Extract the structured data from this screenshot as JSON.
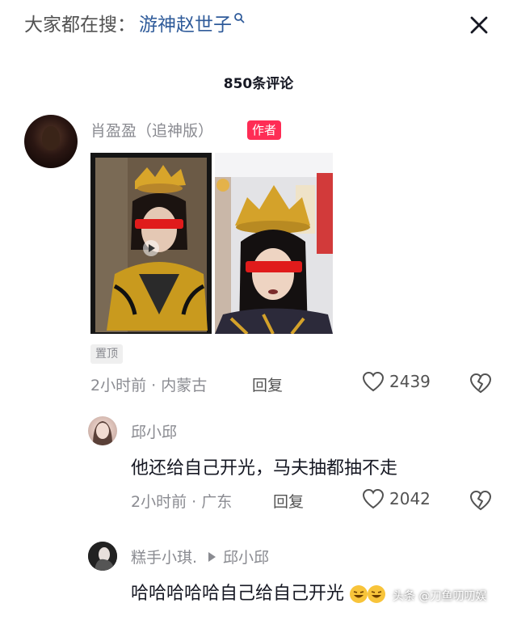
{
  "header": {
    "search_prefix": "大家都在搜：",
    "search_term": "游神赵世子",
    "close_icon": "close-icon"
  },
  "comments": {
    "count_label": "850条评论"
  },
  "main_comment": {
    "author": "肖盈盈（追神版）",
    "author_badge": "作者",
    "pinned": "置顶",
    "time_location": "2小时前 · 内蒙古",
    "reply_label": "回复",
    "likes": "2439"
  },
  "replies": [
    {
      "author": "邱小邱",
      "text": "他还给自己开光，马夫抽都抽不走",
      "time_location": "2小时前 · 广东",
      "reply_label": "回复",
      "likes": "2042"
    },
    {
      "author": "糕手小琪.",
      "reply_to": "邱小邱",
      "text": "哈哈哈哈哈自己给自己开光"
    }
  ],
  "watermark": {
    "text": "头条 @刀鱼叨叨娱"
  },
  "colors": {
    "accent_badge": "#fe2c55",
    "search_term": "#2f5b9a",
    "meta_gray": "#8a8b91"
  }
}
